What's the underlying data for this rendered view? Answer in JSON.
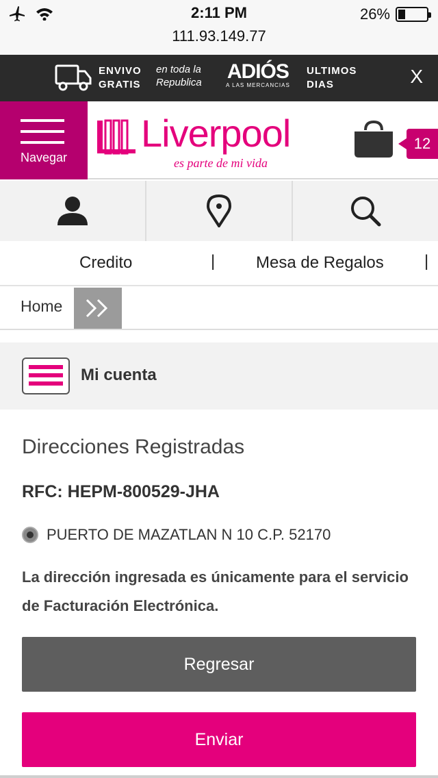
{
  "status_bar": {
    "time": "2:11 PM",
    "url": "111.93.149.77",
    "battery_percent_text": "26%",
    "battery_level": 0.26,
    "icons": [
      "airplane-icon",
      "wifi-icon",
      "battery-icon"
    ]
  },
  "promo": {
    "envio_line1": "ENVIVO",
    "envio_line2": "GRATIS",
    "republica_line1": "en toda la",
    "republica_line2": "Republica",
    "adios_big": "ADIÓS",
    "adios_small": "A LAS MERCANCIAS",
    "ultimos_line1": "ULTIMOS",
    "ultimos_line2": "DIAS",
    "close": "X"
  },
  "header": {
    "nav_label": "Navegar",
    "brand": "Liverpool",
    "tagline": "es parte de mi vida",
    "cart_count": "12",
    "brand_color": "#e4007c"
  },
  "icon_row": [
    "user-icon",
    "location-pin-icon",
    "search-icon"
  ],
  "links": {
    "credito": "Credito",
    "mesa": "Mesa de Regalos",
    "separator": "|"
  },
  "breadcrumb": {
    "home": "Home",
    "arrow": ">>"
  },
  "account": {
    "title": "Mi cuenta"
  },
  "content": {
    "title": "Direcciones Registradas",
    "rfc": "RFC: HEPM-800529-JHA",
    "address": "PUERTO DE MAZATLAN N 10 C.P. 52170",
    "notice": "La dirección ingresada es únicamente para el servicio de Facturación Electrónica."
  },
  "buttons": {
    "back": "Regresar",
    "send": "Enviar"
  }
}
